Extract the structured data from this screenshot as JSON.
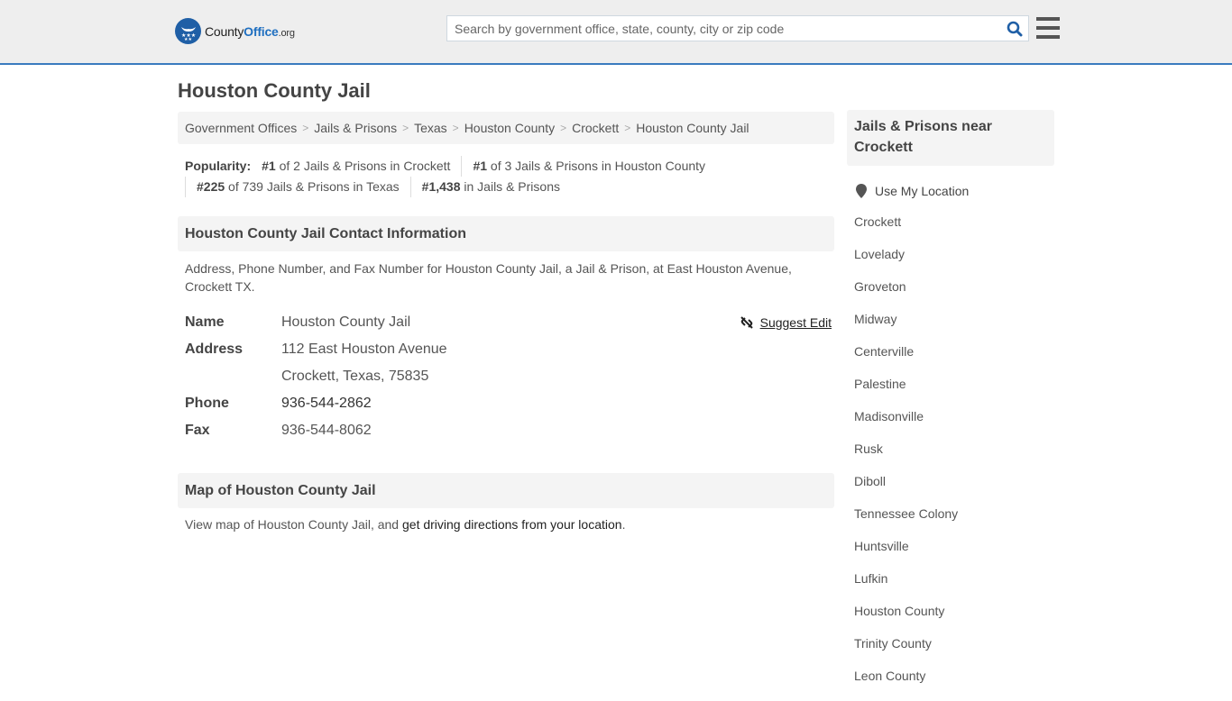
{
  "header": {
    "logo": {
      "part1": "County",
      "part2": "Office",
      "part3": ".org"
    },
    "search": {
      "placeholder": "Search by government office, state, county, city or zip code",
      "value": ""
    },
    "icons": {
      "search": "search-icon",
      "menu": "hamburger-menu-icon"
    },
    "accent_color": "#3a7bbf"
  },
  "page": {
    "title": "Houston County Jail"
  },
  "breadcrumb": [
    {
      "label": "Government Offices"
    },
    {
      "label": "Jails & Prisons"
    },
    {
      "label": "Texas"
    },
    {
      "label": "Houston County"
    },
    {
      "label": "Crockett"
    },
    {
      "label": "Houston County Jail"
    }
  ],
  "popularity": {
    "label": "Popularity:",
    "items": [
      {
        "rank": "#1",
        "text": " of 2 Jails & Prisons in Crockett"
      },
      {
        "rank": "#1",
        "text": " of 3 Jails & Prisons in Houston County"
      },
      {
        "rank": "#225",
        "text": " of 739 Jails & Prisons in Texas"
      },
      {
        "rank": "#1,438",
        "text": " in Jails & Prisons"
      }
    ]
  },
  "contact": {
    "heading": "Houston County Jail Contact Information",
    "description": "Address, Phone Number, and Fax Number for Houston County Jail, a Jail & Prison, at East Houston Avenue, Crockett TX.",
    "suggest_edit": "Suggest Edit",
    "rows": {
      "name_label": "Name",
      "name_value": "Houston County Jail",
      "address_label": "Address",
      "address_line1": "112 East Houston Avenue",
      "address_line2": "Crockett, Texas, 75835",
      "phone_label": "Phone",
      "phone_value": "936-544-2862",
      "fax_label": "Fax",
      "fax_value": "936-544-8062"
    }
  },
  "map": {
    "heading": "Map of Houston County Jail",
    "text_before": "View map of Houston County Jail, and ",
    "link": "get driving directions from your location",
    "text_after": "."
  },
  "sidebar": {
    "heading": "Jails & Prisons near Crockett",
    "use_location": "Use My Location",
    "links": [
      "Crockett",
      "Lovelady",
      "Groveton",
      "Midway",
      "Centerville",
      "Palestine",
      "Madisonville",
      "Rusk",
      "Diboll",
      "Tennessee Colony",
      "Huntsville",
      "Lufkin",
      "Houston County",
      "Trinity County",
      "Leon County"
    ]
  }
}
